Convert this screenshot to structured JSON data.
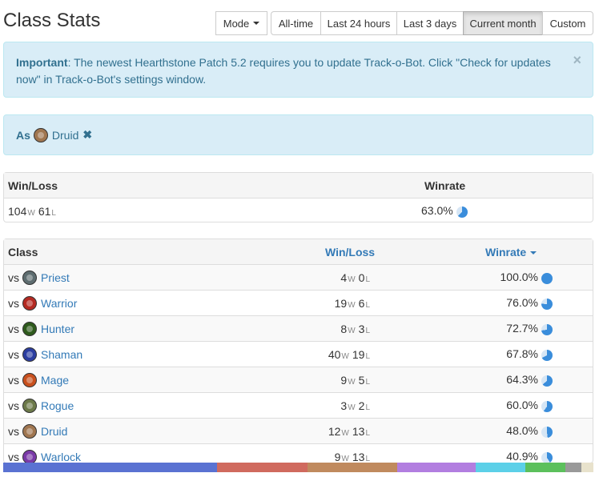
{
  "header": {
    "title": "Class Stats"
  },
  "toolbar": {
    "mode_label": "Mode",
    "ranges": [
      {
        "label": "All-time",
        "active": false
      },
      {
        "label": "Last 24 hours",
        "active": false
      },
      {
        "label": "Last 3 days",
        "active": false
      },
      {
        "label": "Current month",
        "active": true
      },
      {
        "label": "Custom",
        "active": false
      }
    ]
  },
  "alert": {
    "strong": "Important",
    "message": ": The newest Hearthstone Patch 5.2 requires you to update Track-o-Bot. Click \"Check for updates now\" in Track-o-Bot's settings window.",
    "close_glyph": "×"
  },
  "filter": {
    "as_label": "As",
    "class_name": "Druid",
    "class_color": "#a07650",
    "remove_glyph": "✖"
  },
  "summary": {
    "headers": {
      "winloss": "Win/Loss",
      "winrate": "Winrate"
    },
    "wins": "104",
    "losses": "61",
    "w_suffix": "W",
    "l_suffix": "L",
    "winrate": "63.0%",
    "winrate_value": 0.63
  },
  "classes_table": {
    "headers": {
      "class": "Class",
      "winloss": "Win/Loss",
      "winrate": "Winrate"
    },
    "vs_label": "vs",
    "rows": [
      {
        "name": "Priest",
        "wins": "4",
        "losses": "0",
        "winrate": "100.0%",
        "value": 1.0,
        "icon_color": "#5e6d70"
      },
      {
        "name": "Warrior",
        "wins": "19",
        "losses": "6",
        "winrate": "76.0%",
        "value": 0.76,
        "icon_color": "#b42a22"
      },
      {
        "name": "Hunter",
        "wins": "8",
        "losses": "3",
        "winrate": "72.7%",
        "value": 0.727,
        "icon_color": "#2e5a1c"
      },
      {
        "name": "Shaman",
        "wins": "40",
        "losses": "19",
        "winrate": "67.8%",
        "value": 0.678,
        "icon_color": "#2c3ea0"
      },
      {
        "name": "Mage",
        "wins": "9",
        "losses": "5",
        "winrate": "64.3%",
        "value": 0.643,
        "icon_color": "#c8501e"
      },
      {
        "name": "Rogue",
        "wins": "3",
        "losses": "2",
        "winrate": "60.0%",
        "value": 0.6,
        "icon_color": "#6d7a4a"
      },
      {
        "name": "Druid",
        "wins": "12",
        "losses": "13",
        "winrate": "48.0%",
        "value": 0.48,
        "icon_color": "#a07650"
      },
      {
        "name": "Warlock",
        "wins": "9",
        "losses": "13",
        "winrate": "40.9%",
        "value": 0.409,
        "icon_color": "#7a3aa8"
      }
    ]
  },
  "distribution_bar": [
    {
      "color": "#5a72d2",
      "share": 0.3625
    },
    {
      "color": "#d06a5e",
      "share": 0.1525
    },
    {
      "color": "#c08a5e",
      "share": 0.1525
    },
    {
      "color": "#b27ee0",
      "share": 0.1325
    },
    {
      "color": "#5cd0e8",
      "share": 0.085
    },
    {
      "color": "#5cc05c",
      "share": 0.068
    },
    {
      "color": "#999999",
      "share": 0.027
    },
    {
      "color": "#e8e2cc",
      "share": 0.02
    }
  ],
  "colors": {
    "accent": "#337ab7",
    "pie_fill": "#3a8ddb",
    "pie_bg": "#d6e6f5"
  }
}
